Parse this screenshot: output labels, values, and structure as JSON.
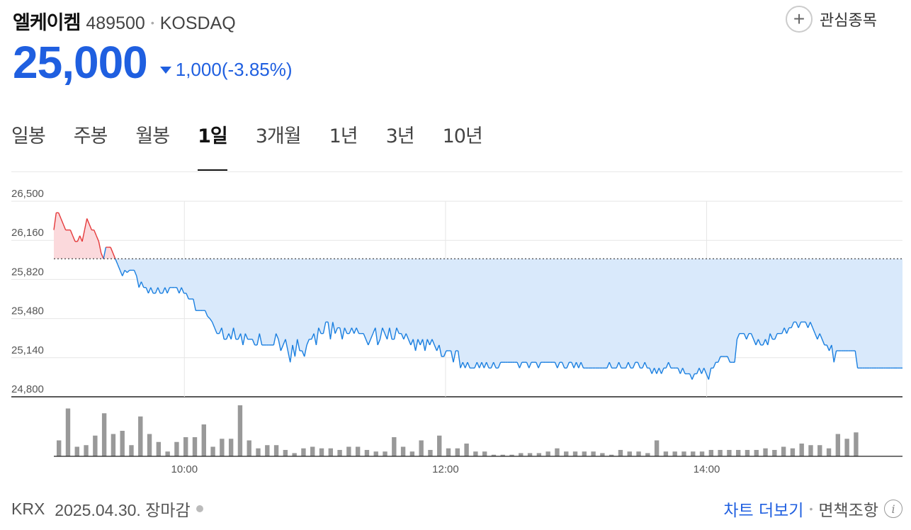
{
  "stock": {
    "name": "엘케이켐",
    "code": "489500",
    "market": "KOSDAQ",
    "price": "25,000",
    "change": "1,000(-3.85%)",
    "direction": "down",
    "watch_label": "관심종목"
  },
  "tabs": [
    {
      "label": "일봉",
      "active": false
    },
    {
      "label": "주봉",
      "active": false
    },
    {
      "label": "월봉",
      "active": false
    },
    {
      "label": "1일",
      "active": true
    },
    {
      "label": "3개월",
      "active": false
    },
    {
      "label": "1년",
      "active": false
    },
    {
      "label": "3년",
      "active": false
    },
    {
      "label": "10년",
      "active": false
    }
  ],
  "footer": {
    "exchange": "KRX",
    "date_status": "2025.04.30. 장마감",
    "more_chart": "차트 더보기",
    "disclaimer": "면책조항"
  },
  "colors": {
    "down": "#1f5fe0",
    "up": "#e5393a",
    "line_down": "#1a7fe0",
    "fill_down": "#d9e9fb",
    "fill_up": "#fbd9dc",
    "volume": "#999999"
  },
  "chart_data": {
    "type": "area",
    "baseline": 26000,
    "ylim": [
      24800,
      26500
    ],
    "y_ticks": [
      "26,500",
      "26,160",
      "25,820",
      "25,480",
      "25,140",
      "24,800"
    ],
    "x_ticks": [
      "10:00",
      "12:00",
      "14:00"
    ],
    "x_tick_hours": [
      10,
      12,
      14
    ],
    "time_start": "09:00",
    "time_end": "15:30",
    "series": [
      {
        "values": [
          26250,
          26400,
          26400,
          26350,
          26300,
          26250,
          26250,
          26250,
          26200,
          26150,
          26150,
          26200,
          26150,
          26250,
          26350,
          26300,
          26250,
          26250,
          26200,
          26150,
          26050,
          26000,
          26100,
          26100,
          26100,
          26050,
          26000,
          25950,
          25900,
          25850,
          25900,
          25880,
          25900,
          25900,
          25900,
          25850,
          25750,
          25800,
          25750,
          25750,
          25700,
          25750,
          25700,
          25700,
          25750,
          25700,
          25700,
          25750,
          25700,
          25750,
          25750,
          25750,
          25750,
          25700,
          25750,
          25700,
          25700,
          25650,
          25650,
          25650,
          25550,
          25550,
          25550,
          25550,
          25550,
          25500,
          25480,
          25450,
          25400,
          25350,
          25350,
          25400,
          25300,
          25300,
          25350,
          25300,
          25400,
          25300,
          25300,
          25350,
          25250,
          25350,
          25300,
          25300,
          25300,
          25250,
          25250,
          25350,
          25250,
          25250,
          25250,
          25250,
          25250,
          25250,
          25350,
          25300,
          25200,
          25250,
          25300,
          25200,
          25100,
          25250,
          25150,
          25300,
          25200,
          25200,
          25150,
          25250,
          25300,
          25300,
          25350,
          25250,
          25400,
          25350,
          25350,
          25450,
          25450,
          25300,
          25450,
          25350,
          25400,
          25400,
          25300,
          25400,
          25350,
          25350,
          25400,
          25350,
          25400,
          25350,
          25350,
          25350,
          25300,
          25250,
          25300,
          25350,
          25400,
          25250,
          25300,
          25400,
          25350,
          25300,
          25400,
          25300,
          25300,
          25400,
          25350,
          25350,
          25300,
          25350,
          25300,
          25250,
          25300,
          25200,
          25300,
          25250,
          25300,
          25200,
          25300,
          25250,
          25300,
          25250,
          25200,
          25250,
          25150,
          25150,
          25200,
          25200,
          25200,
          25100,
          25200,
          25200,
          25050,
          25100,
          25050,
          25100,
          25050,
          25050,
          25050,
          25100,
          25050,
          25100,
          25050,
          25100,
          25050,
          25050,
          25100,
          25050,
          25050,
          25100,
          25100,
          25100,
          25100,
          25100,
          25100,
          25100,
          25100,
          25050,
          25100,
          25100,
          25100,
          25050,
          25100,
          25100,
          25100,
          25050,
          25100,
          25100,
          25100,
          25100,
          25100,
          25100,
          25100,
          25050,
          25100,
          25100,
          25050,
          25050,
          25100,
          25100,
          25050,
          25100,
          25050,
          25100,
          25050,
          25050,
          25050,
          25050,
          25050,
          25050,
          25050,
          25050,
          25050,
          25050,
          25050,
          25100,
          25050,
          25050,
          25050,
          25100,
          25050,
          25050,
          25050,
          25100,
          25050,
          25050,
          25100,
          25100,
          25050,
          25050,
          25100,
          25050,
          25050,
          25000,
          25050,
          25000,
          25050,
          25000,
          25050,
          25050,
          25100,
          25050,
          25050,
          25050,
          25050,
          25000,
          25050,
          25000,
          25000,
          25000,
          24950,
          25000,
          25000,
          25050,
          25000,
          25050,
          25000,
          24950,
          25050,
          25050,
          25100,
          25100,
          25150,
          25150,
          25150,
          25150,
          25100,
          25100,
          25100,
          25300,
          25350,
          25350,
          25350,
          25300,
          25350,
          25350,
          25300,
          25250,
          25300,
          25250,
          25250,
          25300,
          25250,
          25350,
          25300,
          25300,
          25350,
          25350,
          25350,
          25400,
          25350,
          25400,
          25400,
          25450,
          25450,
          25400,
          25450,
          25450,
          25450,
          25400,
          25450,
          25400,
          25350,
          25300,
          25350,
          25300,
          25250,
          25250,
          25200,
          25250,
          25100,
          25200,
          25200,
          25200,
          25200,
          25200,
          25200,
          25200,
          25200,
          25200,
          25050,
          25050,
          25050,
          25050,
          25050,
          25050,
          25050,
          25050,
          25050,
          25050,
          25050,
          25050,
          25050,
          25050,
          25050,
          25050,
          25050,
          25050,
          25050,
          25050
        ]
      }
    ],
    "volume": [
      10,
      30,
      6,
      7,
      13,
      27,
      14,
      16,
      7,
      25,
      14,
      9,
      3,
      9,
      12,
      12,
      20,
      6,
      11,
      11,
      32,
      10,
      5,
      7,
      7,
      4,
      2,
      5,
      6,
      5,
      5,
      4,
      6,
      6,
      4,
      3,
      3,
      12,
      6,
      3,
      10,
      4,
      13,
      5,
      5,
      8,
      3,
      3,
      1,
      1,
      1,
      2,
      2,
      2,
      3,
      5,
      3,
      3,
      3,
      3,
      2,
      1,
      4,
      3,
      3,
      2,
      10,
      3,
      3,
      3,
      3,
      3,
      4,
      4,
      4,
      4,
      4,
      4,
      5,
      4,
      6,
      5,
      8,
      7,
      7,
      5,
      14,
      11,
      15
    ]
  }
}
